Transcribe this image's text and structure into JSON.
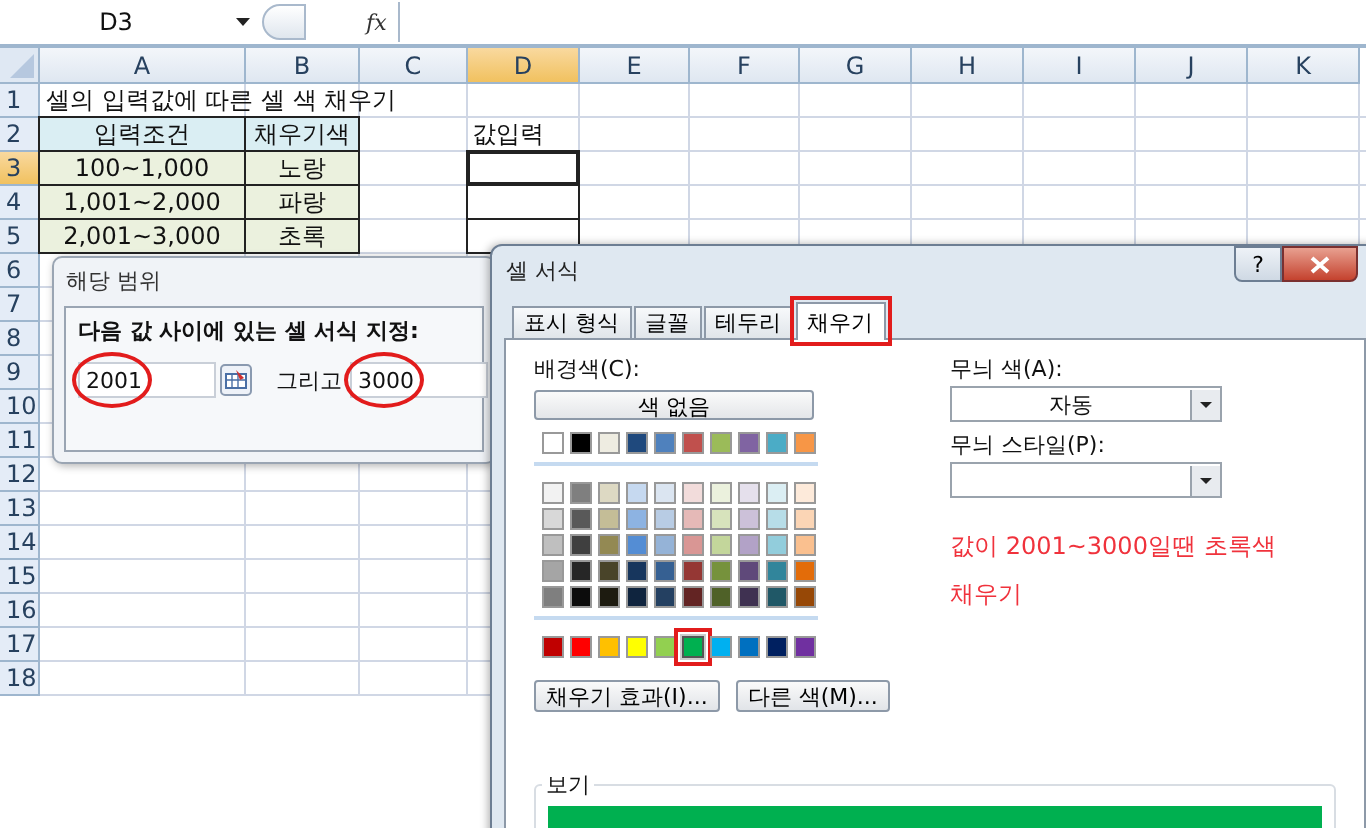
{
  "formula_bar": {
    "name_box": "D3",
    "formula_button": "fx"
  },
  "sheet": {
    "columns": [
      {
        "label": "A",
        "selected": false
      },
      {
        "label": "B",
        "selected": false
      },
      {
        "label": "C",
        "selected": false
      },
      {
        "label": "D",
        "selected": true
      },
      {
        "label": "E",
        "selected": false
      },
      {
        "label": "F",
        "selected": false
      },
      {
        "label": "G",
        "selected": false
      },
      {
        "label": "H",
        "selected": false
      },
      {
        "label": "I",
        "selected": false
      },
      {
        "label": "J",
        "selected": false
      },
      {
        "label": "K",
        "selected": false
      }
    ],
    "rows": [
      {
        "label": "1",
        "selected": false
      },
      {
        "label": "2",
        "selected": false
      },
      {
        "label": "3",
        "selected": true
      },
      {
        "label": "4",
        "selected": false
      },
      {
        "label": "5",
        "selected": false
      },
      {
        "label": "6",
        "selected": false
      },
      {
        "label": "7",
        "selected": false
      },
      {
        "label": "8",
        "selected": false
      },
      {
        "label": "9",
        "selected": false
      },
      {
        "label": "10",
        "selected": false
      },
      {
        "label": "11",
        "selected": false
      },
      {
        "label": "12",
        "selected": false
      },
      {
        "label": "13",
        "selected": false
      },
      {
        "label": "14",
        "selected": false
      },
      {
        "label": "15",
        "selected": false
      },
      {
        "label": "16",
        "selected": false
      },
      {
        "label": "17",
        "selected": false
      },
      {
        "label": "18",
        "selected": false
      }
    ],
    "title": "셀의 입력값에 따른 셀 색 채우기",
    "table": {
      "columns": [
        "입력조건",
        "채우기색"
      ],
      "rows": [
        [
          "100~1,000",
          "노랑"
        ],
        [
          "1,001~2,000",
          "파랑"
        ],
        [
          "2,001~3,000",
          "초록"
        ]
      ]
    },
    "input_label": "값입력",
    "input_cells": [
      {
        "selected": true
      },
      {
        "selected": false
      },
      {
        "selected": false
      }
    ]
  },
  "between_dialog": {
    "title": "해당 범위",
    "prompt": "다음 값 사이에 있는 셀 서식 지정:",
    "fields": [
      {
        "value": "2001",
        "highlighted": true
      },
      {
        "value": "3000",
        "highlighted": true
      }
    ],
    "connector": "그리고"
  },
  "format_dialog": {
    "title": "셀 서식",
    "help_button": "?",
    "tabs": [
      {
        "label": "표시 형식",
        "selected": false,
        "highlighted": false
      },
      {
        "label": "글꼴",
        "selected": false,
        "highlighted": false
      },
      {
        "label": "테두리",
        "selected": false,
        "highlighted": false
      },
      {
        "label": "채우기",
        "selected": true,
        "highlighted": true
      }
    ],
    "background_label": "배경색(C):",
    "no_color_button": "색 없음",
    "theme_colors": [
      {
        "color": "#ffffff",
        "selected": false
      },
      {
        "color": "#000000",
        "selected": false
      },
      {
        "color": "#eeece1",
        "selected": false
      },
      {
        "color": "#1f497d",
        "selected": false
      },
      {
        "color": "#4f81bd",
        "selected": false
      },
      {
        "color": "#c0504d",
        "selected": false
      },
      {
        "color": "#9bbb59",
        "selected": false
      },
      {
        "color": "#8064a2",
        "selected": false
      },
      {
        "color": "#4bacc6",
        "selected": false
      },
      {
        "color": "#f79646",
        "selected": false
      }
    ],
    "shades": [
      [
        {
          "color": "#f2f2f2",
          "selected": false
        },
        {
          "color": "#7f7f7f",
          "selected": false
        },
        {
          "color": "#ddd9c3",
          "selected": false
        },
        {
          "color": "#c6d9f0",
          "selected": false
        },
        {
          "color": "#dbe5f1",
          "selected": false
        },
        {
          "color": "#f2dcdb",
          "selected": false
        },
        {
          "color": "#ebf1dd",
          "selected": false
        },
        {
          "color": "#e5e0ec",
          "selected": false
        },
        {
          "color": "#dbeef3",
          "selected": false
        },
        {
          "color": "#fdeada",
          "selected": false
        }
      ],
      [
        {
          "color": "#d8d8d8",
          "selected": false
        },
        {
          "color": "#595959",
          "selected": false
        },
        {
          "color": "#c4bd97",
          "selected": false
        },
        {
          "color": "#8db3e2",
          "selected": false
        },
        {
          "color": "#b8cce4",
          "selected": false
        },
        {
          "color": "#e5b9b7",
          "selected": false
        },
        {
          "color": "#d7e3bc",
          "selected": false
        },
        {
          "color": "#ccc1d9",
          "selected": false
        },
        {
          "color": "#b7dde8",
          "selected": false
        },
        {
          "color": "#fbd5b5",
          "selected": false
        }
      ],
      [
        {
          "color": "#bfbfbf",
          "selected": false
        },
        {
          "color": "#3f3f3f",
          "selected": false
        },
        {
          "color": "#938953",
          "selected": false
        },
        {
          "color": "#548dd4",
          "selected": false
        },
        {
          "color": "#95b3d7",
          "selected": false
        },
        {
          "color": "#d99694",
          "selected": false
        },
        {
          "color": "#c3d69b",
          "selected": false
        },
        {
          "color": "#b2a2c7",
          "selected": false
        },
        {
          "color": "#92cddc",
          "selected": false
        },
        {
          "color": "#fac08f",
          "selected": false
        }
      ],
      [
        {
          "color": "#a5a5a5",
          "selected": false
        },
        {
          "color": "#262626",
          "selected": false
        },
        {
          "color": "#494429",
          "selected": false
        },
        {
          "color": "#17365d",
          "selected": false
        },
        {
          "color": "#366092",
          "selected": false
        },
        {
          "color": "#953734",
          "selected": false
        },
        {
          "color": "#76923c",
          "selected": false
        },
        {
          "color": "#5f497a",
          "selected": false
        },
        {
          "color": "#31859b",
          "selected": false
        },
        {
          "color": "#e36c09",
          "selected": false
        }
      ],
      [
        {
          "color": "#7f7f7f",
          "selected": false
        },
        {
          "color": "#0c0c0c",
          "selected": false
        },
        {
          "color": "#1d1b10",
          "selected": false
        },
        {
          "color": "#0f243e",
          "selected": false
        },
        {
          "color": "#244061",
          "selected": false
        },
        {
          "color": "#632423",
          "selected": false
        },
        {
          "color": "#4f6128",
          "selected": false
        },
        {
          "color": "#3f3151",
          "selected": false
        },
        {
          "color": "#205867",
          "selected": false
        },
        {
          "color": "#974806",
          "selected": false
        }
      ]
    ],
    "standard_colors": [
      {
        "color": "#c00000",
        "selected": false
      },
      {
        "color": "#ff0000",
        "selected": false
      },
      {
        "color": "#ffc000",
        "selected": false
      },
      {
        "color": "#ffff00",
        "selected": false
      },
      {
        "color": "#92d050",
        "selected": false
      },
      {
        "color": "#00b050",
        "selected": true
      },
      {
        "color": "#00b0f0",
        "selected": false
      },
      {
        "color": "#0070c0",
        "selected": false
      },
      {
        "color": "#002060",
        "selected": false
      },
      {
        "color": "#7030a0",
        "selected": false
      }
    ],
    "buttons": [
      "채우기 효과(I)...",
      "다른 색(M)..."
    ],
    "pattern_color_label": "무늬 색(A):",
    "pattern_color": "자동",
    "pattern_style_label": "무늬 스타일(P):",
    "note": "값이 2001~3000일땐 초록색 채우기",
    "sample": {
      "label": "보기",
      "color": "#00b050"
    }
  }
}
